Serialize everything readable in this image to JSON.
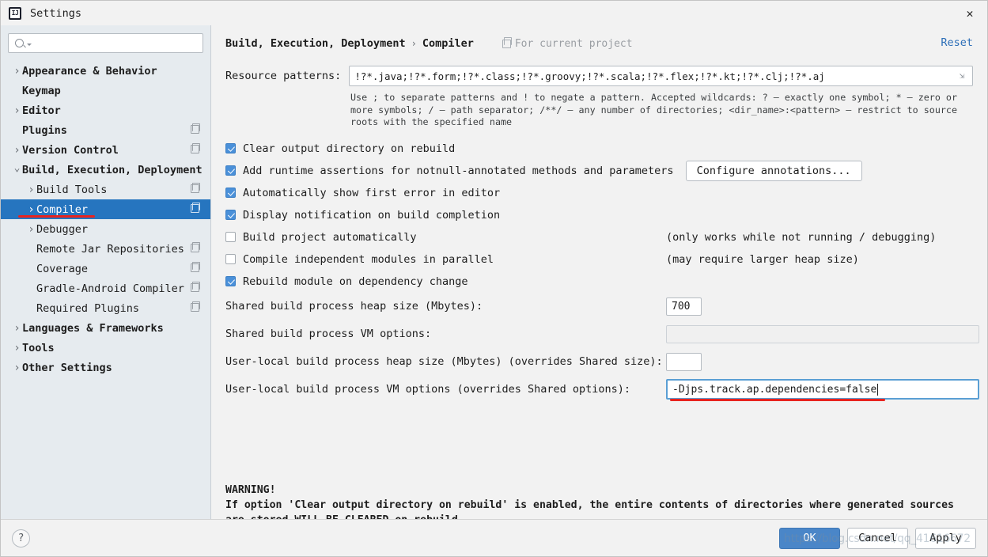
{
  "window": {
    "title": "Settings",
    "logo_text": "IJ",
    "close_icon": "close-icon"
  },
  "sidebar": {
    "search": {
      "placeholder": "",
      "value": "",
      "icon": "search-icon"
    },
    "items": [
      {
        "label": "Appearance & Behavior",
        "level": 0,
        "arrow": "collapsed",
        "bold": true,
        "project_icon": false,
        "selected": false
      },
      {
        "label": "Keymap",
        "level": 0,
        "arrow": "none",
        "bold": true,
        "project_icon": false,
        "selected": false
      },
      {
        "label": "Editor",
        "level": 0,
        "arrow": "collapsed",
        "bold": true,
        "project_icon": false,
        "selected": false
      },
      {
        "label": "Plugins",
        "level": 0,
        "arrow": "none",
        "bold": true,
        "project_icon": true,
        "selected": false
      },
      {
        "label": "Version Control",
        "level": 0,
        "arrow": "collapsed",
        "bold": true,
        "project_icon": true,
        "selected": false
      },
      {
        "label": "Build, Execution, Deployment",
        "level": 0,
        "arrow": "expanded",
        "bold": true,
        "project_icon": false,
        "selected": false
      },
      {
        "label": "Build Tools",
        "level": 1,
        "arrow": "collapsed",
        "bold": false,
        "project_icon": true,
        "selected": false
      },
      {
        "label": "Compiler",
        "level": 1,
        "arrow": "collapsed",
        "bold": false,
        "project_icon": true,
        "selected": true
      },
      {
        "label": "Debugger",
        "level": 1,
        "arrow": "collapsed",
        "bold": false,
        "project_icon": false,
        "selected": false
      },
      {
        "label": "Remote Jar Repositories",
        "level": 1,
        "arrow": "none",
        "bold": false,
        "project_icon": true,
        "selected": false
      },
      {
        "label": "Coverage",
        "level": 1,
        "arrow": "none",
        "bold": false,
        "project_icon": true,
        "selected": false
      },
      {
        "label": "Gradle-Android Compiler",
        "level": 1,
        "arrow": "none",
        "bold": false,
        "project_icon": true,
        "selected": false
      },
      {
        "label": "Required Plugins",
        "level": 1,
        "arrow": "none",
        "bold": false,
        "project_icon": true,
        "selected": false
      },
      {
        "label": "Languages & Frameworks",
        "level": 0,
        "arrow": "collapsed",
        "bold": true,
        "project_icon": false,
        "selected": false
      },
      {
        "label": "Tools",
        "level": 0,
        "arrow": "collapsed",
        "bold": true,
        "project_icon": false,
        "selected": false
      },
      {
        "label": "Other Settings",
        "level": 0,
        "arrow": "collapsed",
        "bold": true,
        "project_icon": false,
        "selected": false
      }
    ]
  },
  "header": {
    "crumb1": "Build, Execution, Deployment",
    "crumb_sep": "›",
    "crumb2": "Compiler",
    "scope_label": "For current project",
    "reset_label": "Reset"
  },
  "resource_patterns": {
    "label": "Resource patterns:",
    "value": "!?*.java;!?*.form;!?*.class;!?*.groovy;!?*.scala;!?*.flex;!?*.kt;!?*.clj;!?*.aj",
    "expand_icon": "expand-icon",
    "hint": "Use ; to separate patterns and ! to negate a pattern. Accepted wildcards: ? — exactly one symbol; * — zero or more symbols; / — path separator; /**/ — any number of directories; <dir_name>:<pattern> — restrict to source roots with the specified name"
  },
  "checkboxes": [
    {
      "label": "Clear output directory on rebuild",
      "checked": true,
      "note": "",
      "button": ""
    },
    {
      "label": "Add runtime assertions for notnull-annotated methods and parameters",
      "checked": true,
      "note": "",
      "button": "Configure annotations..."
    },
    {
      "label": "Automatically show first error in editor",
      "checked": true,
      "note": "",
      "button": ""
    },
    {
      "label": "Display notification on build completion",
      "checked": true,
      "note": "",
      "button": ""
    },
    {
      "label": "Build project automatically",
      "checked": false,
      "note": "(only works while not running / debugging)",
      "button": ""
    },
    {
      "label": "Compile independent modules in parallel",
      "checked": false,
      "note": "(may require larger heap size)",
      "button": ""
    },
    {
      "label": "Rebuild module on dependency change",
      "checked": true,
      "note": "",
      "button": ""
    }
  ],
  "fields": [
    {
      "label": "Shared build process heap size (Mbytes):",
      "value": "700",
      "size": "small",
      "disabled": false,
      "focused": false
    },
    {
      "label": "Shared build process VM options:",
      "value": "",
      "size": "wide",
      "disabled": true,
      "focused": false
    },
    {
      "label": "User-local build process heap size (Mbytes) (overrides Shared size):",
      "value": "",
      "size": "small",
      "disabled": false,
      "focused": false
    },
    {
      "label": "User-local build process VM options (overrides Shared options):",
      "value": "-Djps.track.ap.dependencies=false",
      "size": "wide",
      "disabled": false,
      "focused": true
    }
  ],
  "warning": {
    "line1": "WARNING!",
    "line2": "If option 'Clear output directory on rebuild' is enabled, the entire contents of directories where generated sources",
    "line3": "are stored WILL BE CLEARED on rebuild."
  },
  "footer": {
    "help_label": "?",
    "ok_label": "OK",
    "cancel_label": "Cancel",
    "apply_label": "Apply"
  },
  "watermark": {
    "text": "https://blog.csdn.net/qq_41616672"
  },
  "colors": {
    "selection_blue": "#2675bf",
    "accent_link": "#2d6fb8",
    "checkbox_blue": "#4a90d9",
    "annotation_red": "#e8231f",
    "sidebar_bg": "#e6ebef",
    "main_bg": "#f2f2f2"
  }
}
